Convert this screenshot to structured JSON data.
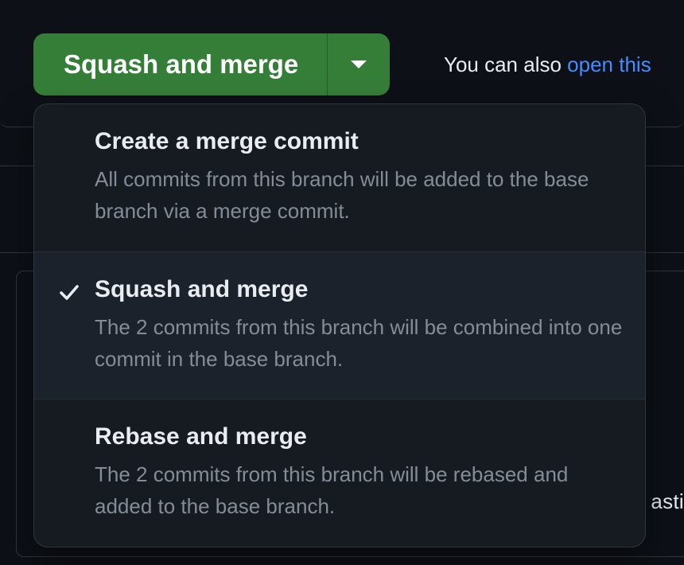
{
  "merge_button": {
    "label": "Squash and merge"
  },
  "hint": {
    "prefix": "You can also ",
    "link": "open this"
  },
  "dropdown": {
    "items": [
      {
        "title": "Create a merge commit",
        "desc": "All commits from this branch will be added to the base branch via a merge commit.",
        "selected": false
      },
      {
        "title": "Squash and merge",
        "desc": "The 2 commits from this branch will be combined into one commit in the base branch.",
        "selected": true
      },
      {
        "title": "Rebase and merge",
        "desc": "The 2 commits from this branch will be rebased and added to the base branch.",
        "selected": false
      }
    ]
  },
  "bg_fragment": "asti"
}
